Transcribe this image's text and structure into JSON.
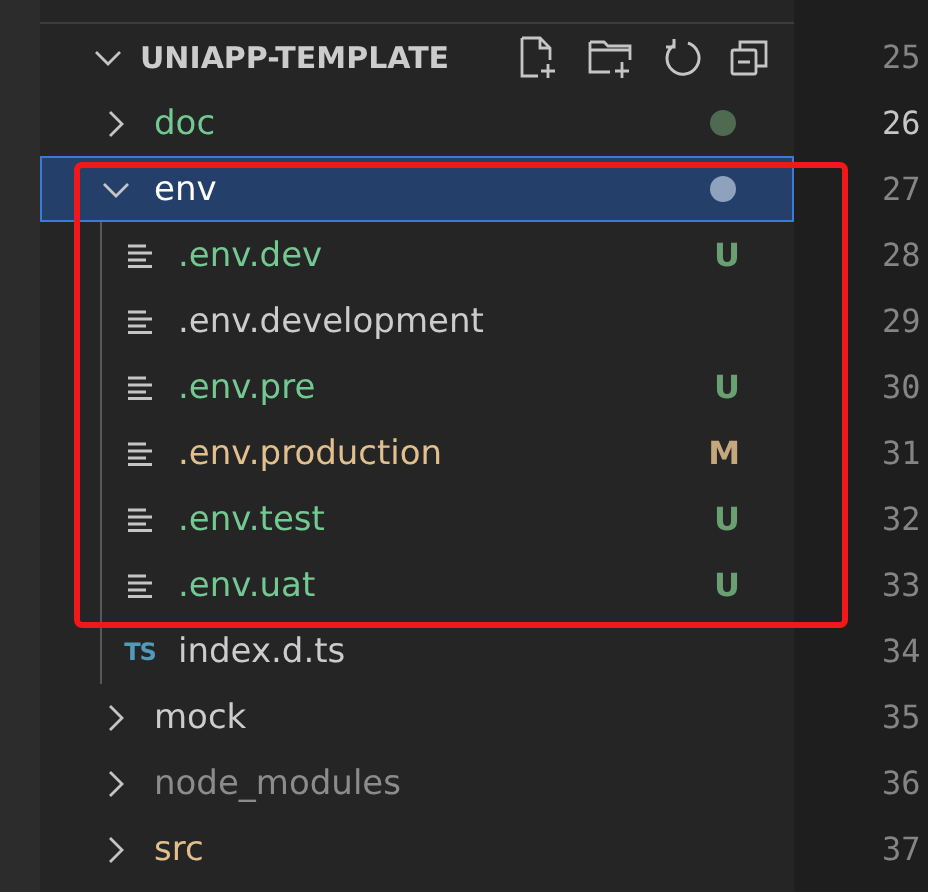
{
  "explorer": {
    "title": "UNIAPP-TEMPLATE",
    "expanded": true,
    "items": [
      {
        "kind": "folder",
        "name": "doc",
        "expanded": false,
        "selected": false,
        "color": "#73c991",
        "decoration": {
          "kind": "dot",
          "color": "#4e6b51"
        }
      },
      {
        "kind": "folder",
        "name": "env",
        "expanded": true,
        "selected": true,
        "color": "#ffffff",
        "decoration": {
          "kind": "dot",
          "color": "#8ea1bd"
        },
        "children": [
          {
            "kind": "text-file",
            "name": ".env.dev",
            "selected": false,
            "color": "#73c991",
            "decoration": {
              "kind": "letter",
              "label": "U",
              "color": "#6a9f71"
            }
          },
          {
            "kind": "text-file",
            "name": ".env.development",
            "selected": false,
            "color": "#cccccc"
          },
          {
            "kind": "text-file",
            "name": ".env.pre",
            "selected": false,
            "color": "#73c991",
            "decoration": {
              "kind": "letter",
              "label": "U",
              "color": "#6a9f71"
            }
          },
          {
            "kind": "text-file",
            "name": ".env.production",
            "selected": false,
            "color": "#e2c08d",
            "decoration": {
              "kind": "letter",
              "label": "M",
              "color": "#c4a87d"
            }
          },
          {
            "kind": "text-file",
            "name": ".env.test",
            "selected": false,
            "color": "#73c991",
            "decoration": {
              "kind": "letter",
              "label": "U",
              "color": "#6a9f71"
            }
          },
          {
            "kind": "text-file",
            "name": ".env.uat",
            "selected": false,
            "color": "#73c991",
            "decoration": {
              "kind": "letter",
              "label": "U",
              "color": "#6a9f71"
            }
          },
          {
            "kind": "ts-file",
            "icon_label": "TS",
            "name": "index.d.ts",
            "selected": false,
            "color": "#cccccc"
          }
        ]
      },
      {
        "kind": "folder",
        "name": "mock",
        "expanded": false,
        "selected": false,
        "color": "#cccccc"
      },
      {
        "kind": "folder",
        "name": "node_modules",
        "expanded": false,
        "selected": false,
        "color": "#8c8c8c"
      },
      {
        "kind": "folder",
        "name": "src",
        "expanded": false,
        "selected": false,
        "color": "#e2c08d"
      }
    ]
  },
  "gutter": {
    "lines": [
      {
        "number": "25",
        "active": false
      },
      {
        "number": "26",
        "active": true
      },
      {
        "number": "27",
        "active": false
      },
      {
        "number": "28",
        "active": false
      },
      {
        "number": "29",
        "active": false
      },
      {
        "number": "30",
        "active": false
      },
      {
        "number": "31",
        "active": false
      },
      {
        "number": "32",
        "active": false
      },
      {
        "number": "33",
        "active": false
      },
      {
        "number": "34",
        "active": false
      },
      {
        "number": "35",
        "active": false
      },
      {
        "number": "36",
        "active": false
      },
      {
        "number": "37",
        "active": false
      }
    ]
  },
  "annotation": {
    "kind": "red-frame"
  }
}
